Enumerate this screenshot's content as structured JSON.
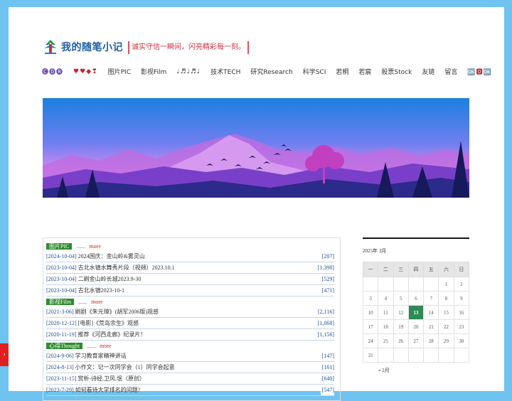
{
  "site": {
    "brand": "我的随笔小记",
    "tagline": "诚实守信一瞬间，闪亮精彩每一刻。"
  },
  "nav": [
    {
      "label": "🅒🅓🅡"
    },
    {
      "label": "♥♥◆❣"
    },
    {
      "label": "图片PIC"
    },
    {
      "label": "影视Film"
    },
    {
      "label": "♩♬♩♬♩"
    },
    {
      "label": "技术TECH"
    },
    {
      "label": "研究Research"
    },
    {
      "label": "科学SCI"
    },
    {
      "label": "若桐"
    },
    {
      "label": "若宸"
    },
    {
      "label": "股票Stock"
    },
    {
      "label": "友链"
    },
    {
      "label": "留言"
    },
    {
      "label": "🆗🅾🆗"
    }
  ],
  "sections": [
    {
      "name": "图片PIC",
      "dots": "......",
      "more": "more",
      "posts": [
        {
          "date": "[2024-10-04]",
          "title": "2024国庆：金山岭&雾灵山",
          "count": "[207]"
        },
        {
          "date": "[2023-10-04]",
          "title": "古北水镇水舞秀片段（视频）2023.10.1",
          "count": "[1,398]"
        },
        {
          "date": "[2023-10-04]",
          "title": "二刷金山岭长城2023.9-30",
          "count": "[529]"
        },
        {
          "date": "[2023-10-04]",
          "title": "古北水镇2023-10-1",
          "count": "[471]"
        }
      ]
    },
    {
      "name": "影视Film",
      "dots": "......",
      "more": "more",
      "posts": [
        {
          "date": "[2021-3-06]",
          "title": "刷剧《朱元璋》(胡军2006版)观感",
          "count": "[2,116]"
        },
        {
          "date": "[2020-12-12]",
          "title": "[电影]《荒岛余生》观感",
          "count": "[1,068]"
        },
        {
          "date": "[2020-11-19]",
          "title": "推荐《河西走廊》纪录片！",
          "count": "[1,156]"
        }
      ]
    },
    {
      "name": "心得Thought",
      "dots": "......",
      "more": "more",
      "posts": [
        {
          "date": "[2024-9-06]",
          "title": "学习教育家精神讲话",
          "count": "[147]"
        },
        {
          "date": "[2024-8-13]",
          "title": "小作文：记一次同学会（1）同学会起意",
          "count": "[161]"
        },
        {
          "date": "[2023-11-15]",
          "title": "赏析-诗经.卫风.氓（原创）",
          "count": "[640]"
        },
        {
          "date": "[2023-7-29]",
          "title": "如何看待大学排名的问题?",
          "count": "[547]"
        }
      ]
    }
  ],
  "calendar": {
    "caption": "2025年 3月",
    "weekdays": [
      "一",
      "二",
      "三",
      "四",
      "五",
      "六",
      "日"
    ],
    "weeks": [
      [
        "",
        "",
        "",
        "",
        "",
        "1",
        "2"
      ],
      [
        "3",
        "4",
        "5",
        "6",
        "7",
        "8",
        "9"
      ],
      [
        "10",
        "11",
        "12",
        "13",
        "14",
        "15",
        "16"
      ],
      [
        "17",
        "18",
        "19",
        "20",
        "21",
        "22",
        "23"
      ],
      [
        "24",
        "25",
        "26",
        "27",
        "28",
        "29",
        "30"
      ],
      [
        "31",
        "",
        "",
        "",
        "",
        "",
        ""
      ]
    ],
    "today": "13",
    "prev_link": "« 2月"
  },
  "side_tab": "›",
  "colors": {
    "page_bg": "#6ec3f0",
    "brand": "#1e5ea8",
    "tag_green": "#2e8b2e",
    "today_green": "#2e8b57",
    "more_red": "#d02020"
  }
}
